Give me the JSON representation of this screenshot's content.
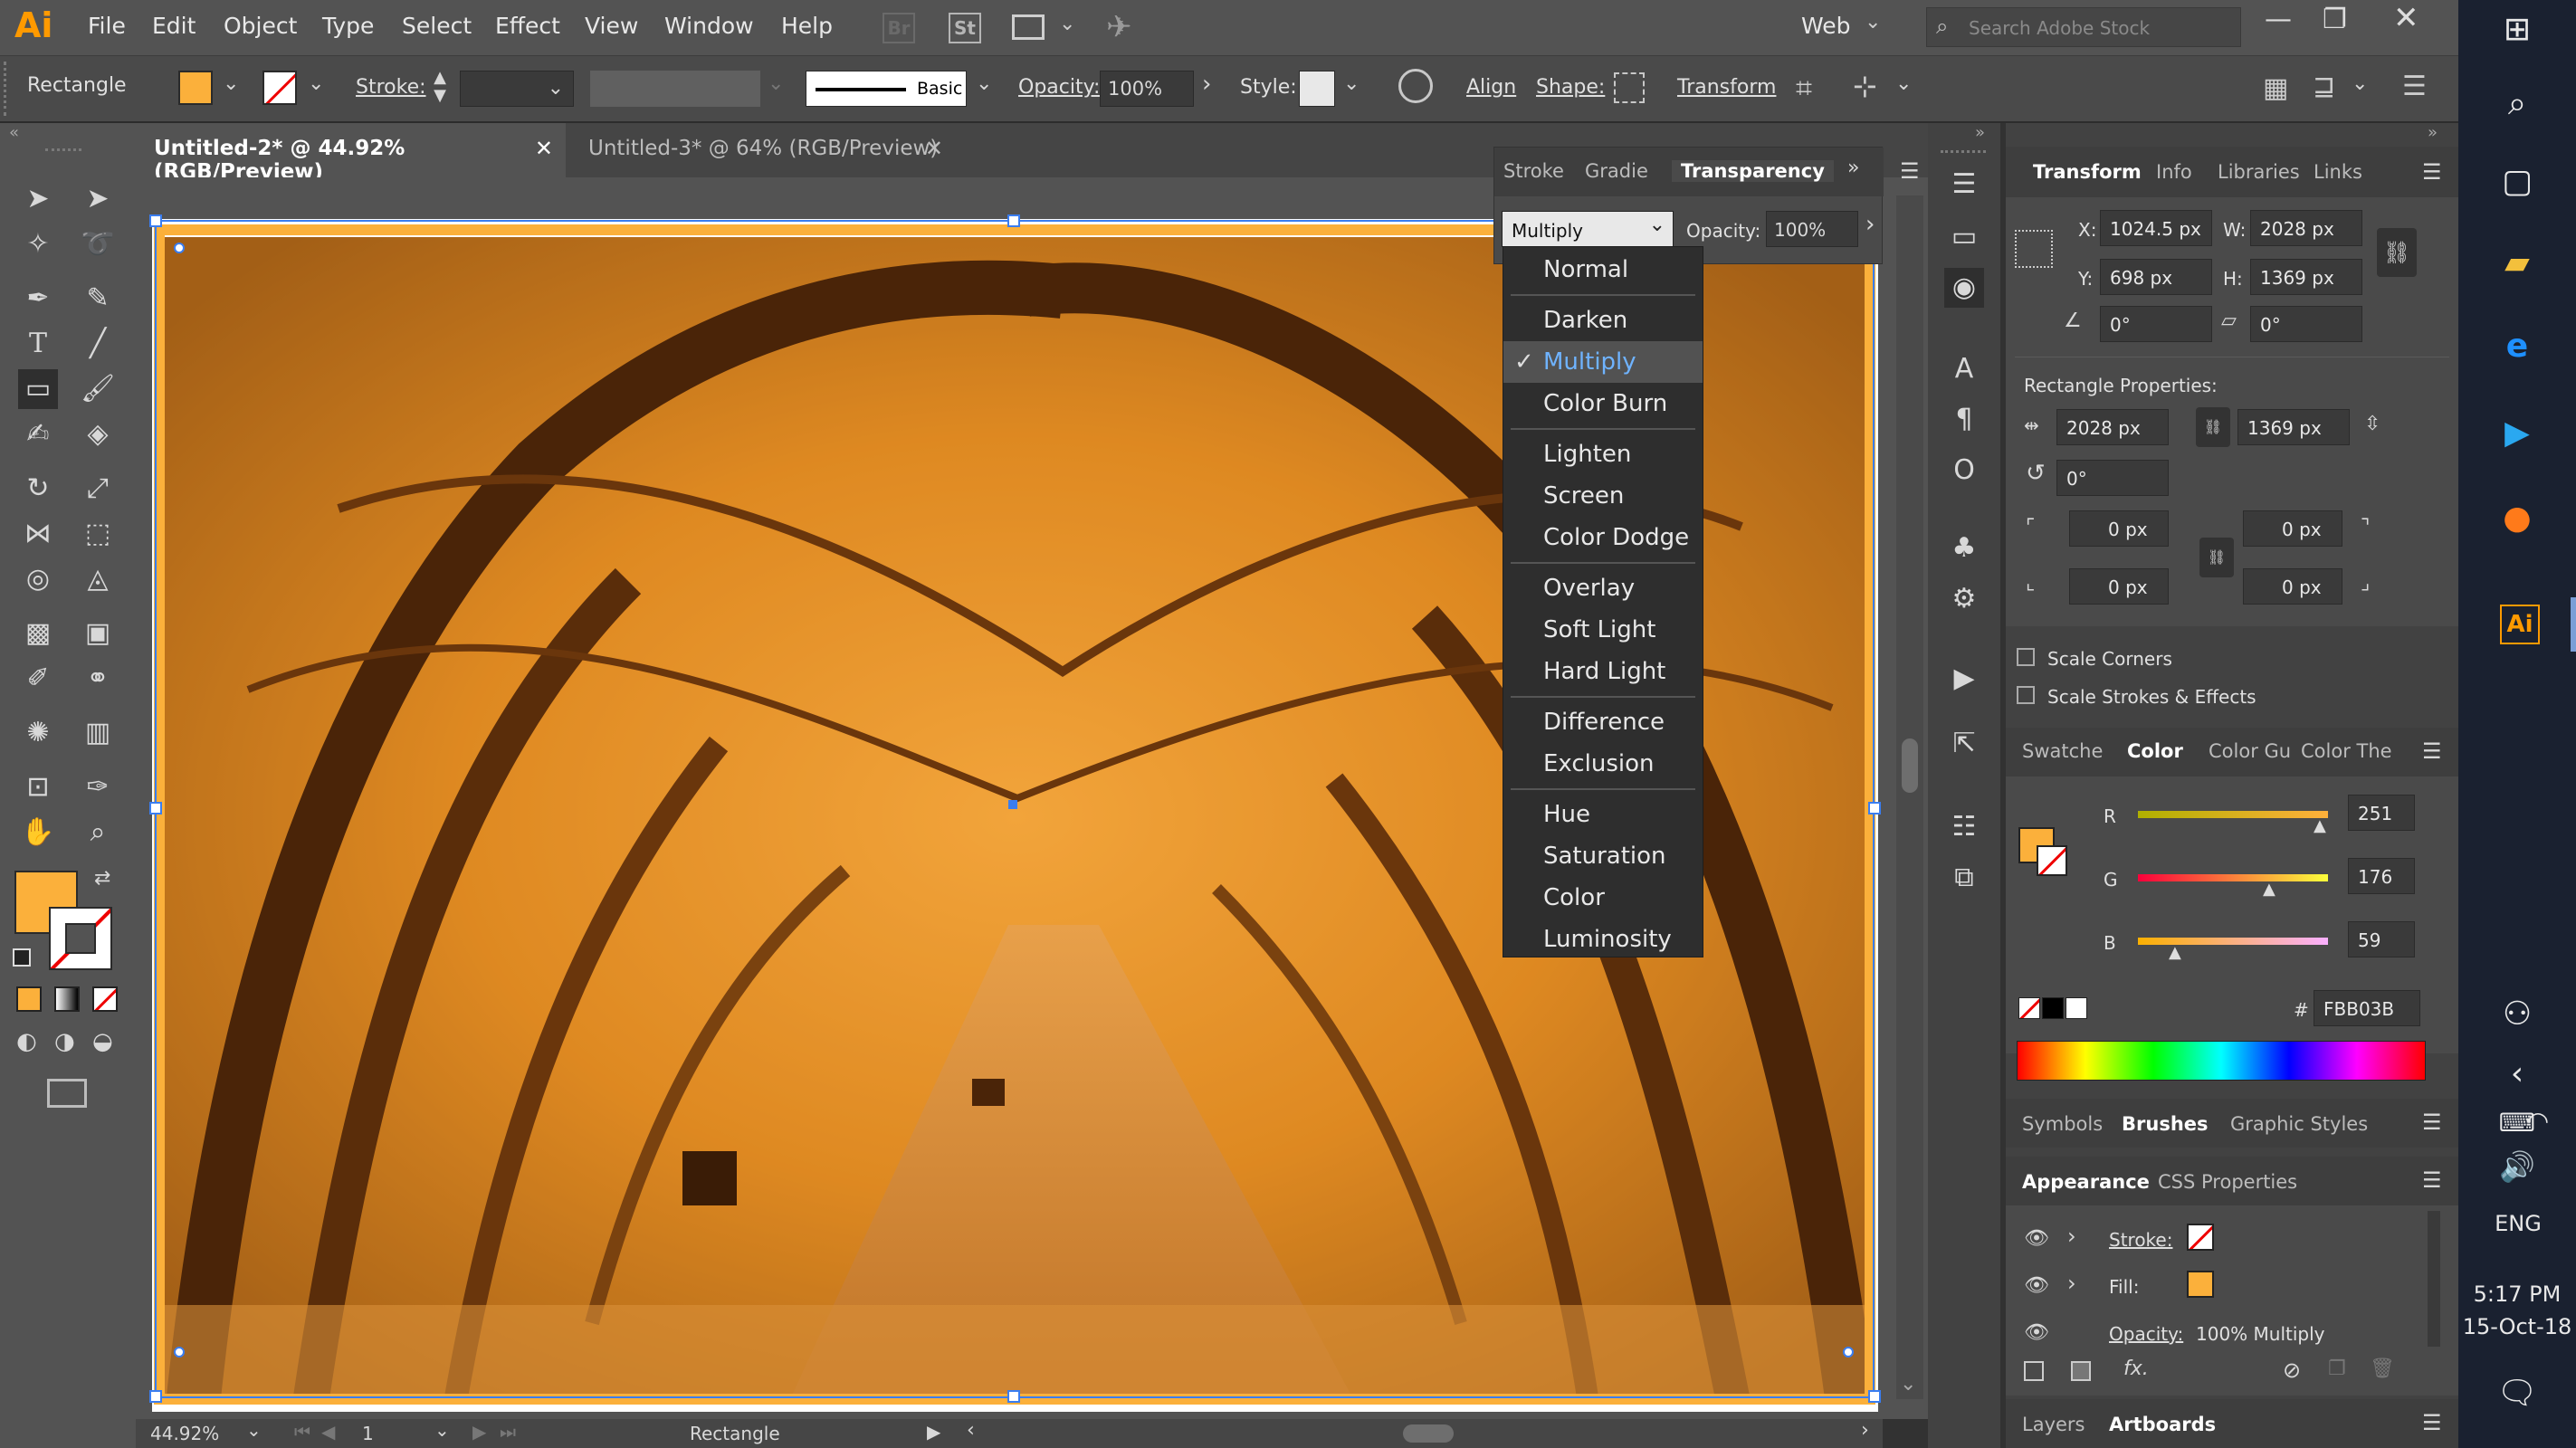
{
  "app": {
    "logo": "Ai",
    "workspace": "Web",
    "search_placeholder": "Search Adobe Stock"
  },
  "menu": [
    "File",
    "Edit",
    "Object",
    "Type",
    "Select",
    "Effect",
    "View",
    "Window",
    "Help"
  ],
  "menu_icons": {
    "bridge": "Br",
    "stock": "St"
  },
  "control_bar": {
    "object_type": "Rectangle",
    "fill_color": "#FBB03B",
    "stroke_label": "Stroke:",
    "brush_label": "Basic",
    "opacity_label": "Opacity:",
    "opacity_value": "100%",
    "style_label": "Style:",
    "align_label": "Align",
    "shape_label": "Shape:",
    "transform_label": "Transform"
  },
  "doc_tabs": [
    {
      "label": "Untitled-2* @ 44.92% (RGB/Preview)",
      "active": true
    },
    {
      "label": "Untitled-3* @ 64% (RGB/Preview)",
      "active": false
    }
  ],
  "transparency_panel": {
    "tabs": [
      "Stroke",
      "Gradie",
      "Transparency"
    ],
    "blend_mode": "Multiply",
    "opacity_label": "Opacity:",
    "opacity_value": "100%",
    "blend_groups": [
      [
        "Normal"
      ],
      [
        "Darken",
        "Multiply",
        "Color Burn"
      ],
      [
        "Lighten",
        "Screen",
        "Color Dodge"
      ],
      [
        "Overlay",
        "Soft Light",
        "Hard Light"
      ],
      [
        "Difference",
        "Exclusion"
      ],
      [
        "Hue",
        "Saturation",
        "Color",
        "Luminosity"
      ]
    ],
    "selected": "Multiply"
  },
  "transform_panel": {
    "tabs": [
      "Transform",
      "Info",
      "Libraries",
      "Links"
    ],
    "x_label": "X:",
    "x": "1024.5 px",
    "y_label": "Y:",
    "y": "698 px",
    "w_label": "W:",
    "w": "2028 px",
    "h_label": "H:",
    "h": "1369 px",
    "angle": "0°",
    "shear": "0°",
    "rect_props_title": "Rectangle Properties:",
    "rect_w": "2028 px",
    "rect_h": "1369 px",
    "rect_angle": "0°",
    "corners": [
      "0 px",
      "0 px",
      "0 px",
      "0 px"
    ],
    "scale_corners": "Scale Corners",
    "scale_strokes": "Scale Strokes & Effects"
  },
  "color_panel": {
    "tabs": [
      "Swatche",
      "Color",
      "Color Gu",
      "Color The"
    ],
    "r_label": "R",
    "r": "251",
    "g_label": "G",
    "g": "176",
    "b_label": "B",
    "b": "59",
    "hex_label": "#",
    "hex": "FBB03B"
  },
  "brush_tabs": [
    "Symbols",
    "Brushes",
    "Graphic Styles"
  ],
  "appearance_panel": {
    "tabs": [
      "Appearance",
      "CSS Properties"
    ],
    "stroke_label": "Stroke:",
    "fill_label": "Fill:",
    "opacity_label": "Opacity:",
    "opacity_value": "100% Multiply",
    "fx_label": "fx."
  },
  "layers_tabs": [
    "Layers",
    "Artboards"
  ],
  "status": {
    "zoom": "44.92%",
    "artboard": "1",
    "tool": "Rectangle"
  },
  "taskbar": {
    "lang": "ENG",
    "time": "5:17 PM",
    "date": "15-Oct-18",
    "ai_icon": "Ai"
  }
}
